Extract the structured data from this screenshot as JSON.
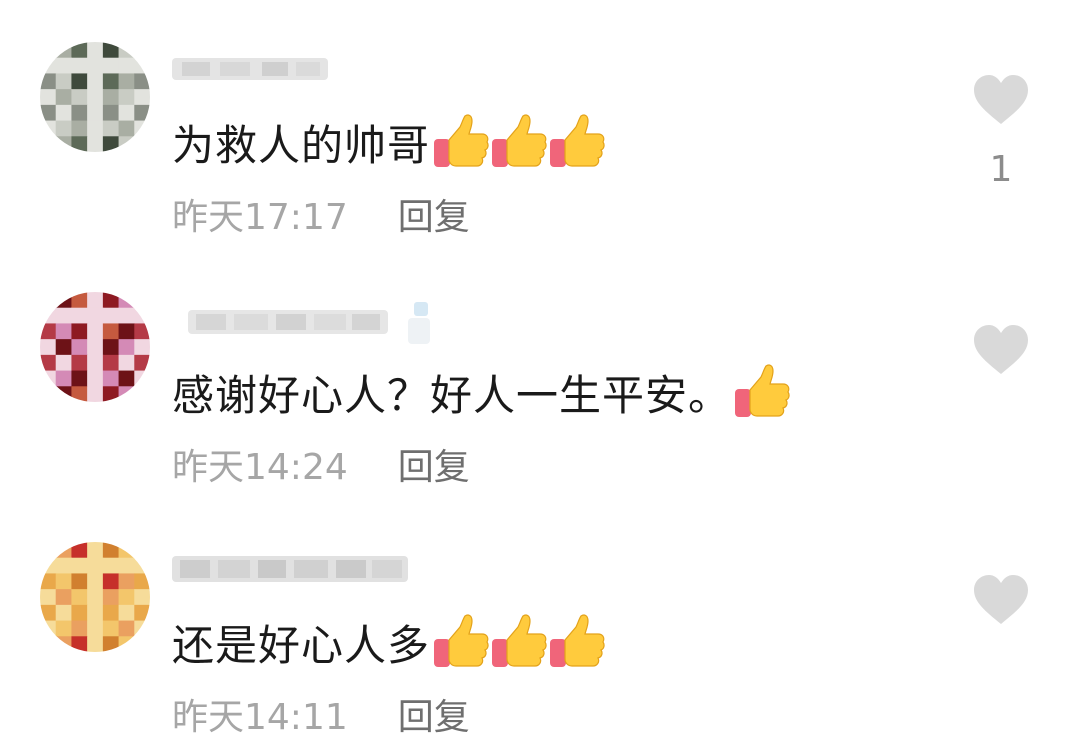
{
  "comments": [
    {
      "text": "为救人的帅哥",
      "thumbs_count": 3,
      "time": "昨天17:17",
      "reply_label": "回复",
      "like_count": "1",
      "avatar_colors": [
        "#8a8f86",
        "#c9ccc4",
        "#3f4a3c",
        "#e2e3de",
        "#5d6a58",
        "#a9aea3"
      ],
      "username_blur": true
    },
    {
      "text": "感谢好心人？好人一生平安。",
      "thumbs_count": 1,
      "time": "昨天14:24",
      "reply_label": "回复",
      "like_count": "",
      "avatar_colors": [
        "#b43a46",
        "#d48ab6",
        "#8e1a22",
        "#f1d7e1",
        "#c55a3f",
        "#6d1217"
      ],
      "username_blur": true
    },
    {
      "text": "还是好心人多",
      "thumbs_count": 3,
      "time": "昨天14:11",
      "reply_label": "回复",
      "like_count": "",
      "avatar_colors": [
        "#e9a84a",
        "#f3c66b",
        "#d1802f",
        "#f6dc9a",
        "#c6302a",
        "#eaa060"
      ],
      "username_blur": true
    }
  ],
  "colors": {
    "heart": "#d9d9d9",
    "time_text": "#a6a6a6",
    "reply_text": "#6f6f6f",
    "comment_text": "#1a1a1a",
    "thumb_yellow": "#ffcb3d",
    "thumb_cuff": "#f0657a"
  },
  "icons": {
    "like": "heart-icon",
    "emoji": "thumbs-up-icon"
  }
}
